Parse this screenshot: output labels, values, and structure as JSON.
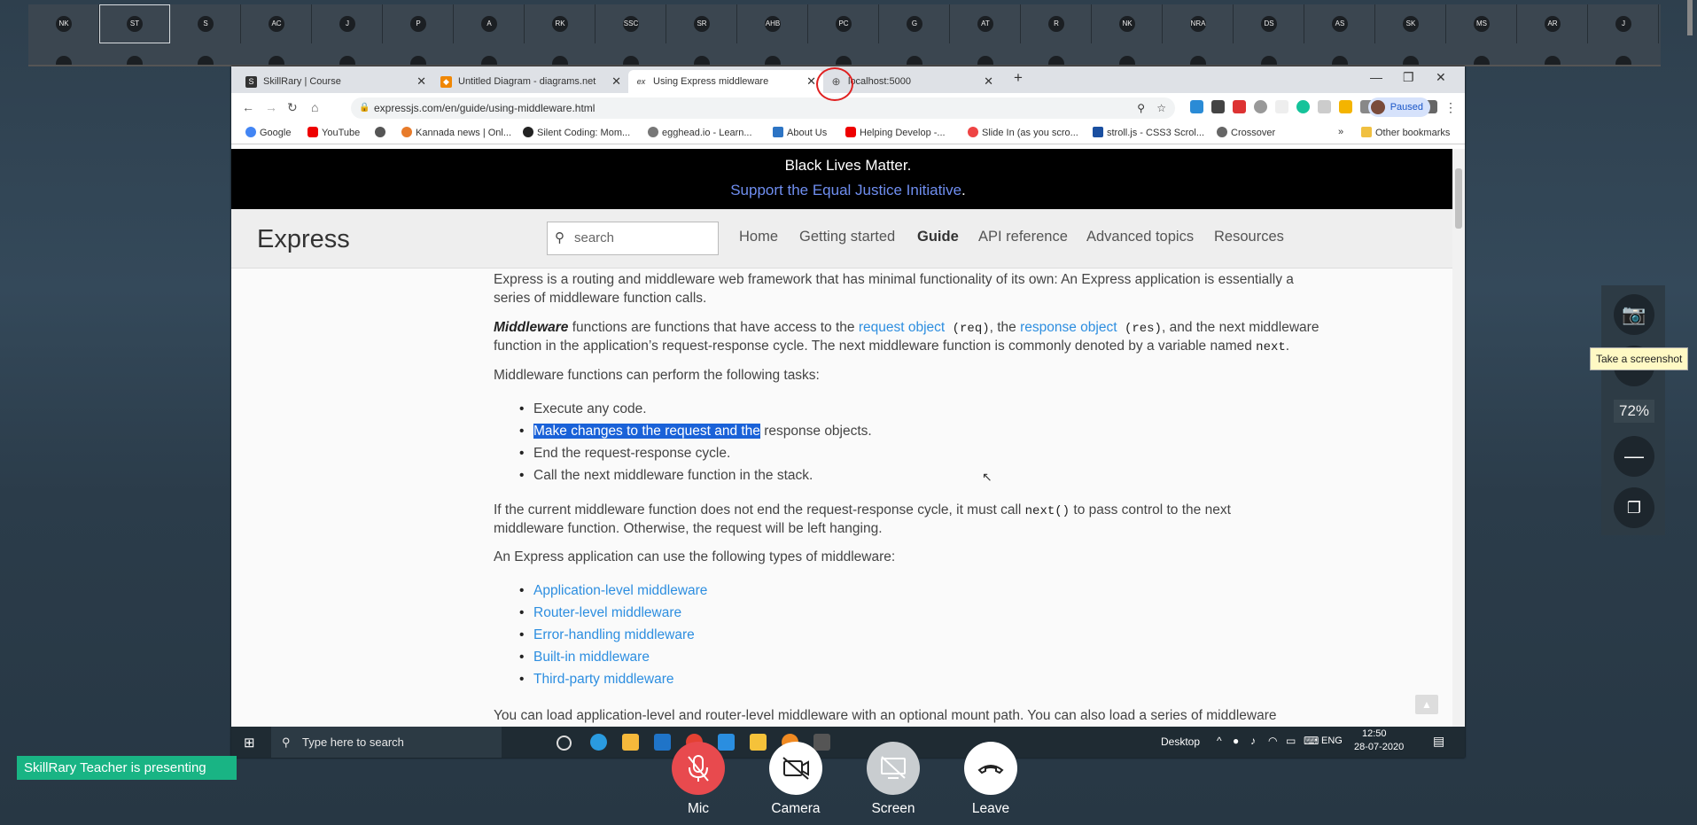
{
  "participants": [
    "NK",
    "ST",
    "S",
    "AC",
    "J",
    "P",
    "A",
    "RK",
    "SSC",
    "SR",
    "AHB",
    "PC",
    "G",
    "AT",
    "R",
    "NK",
    "NRA",
    "DS",
    "AS",
    "SK",
    "MS",
    "AR",
    "J"
  ],
  "browser": {
    "tabs": [
      {
        "title": "SkillRary | Course",
        "favicon": "S"
      },
      {
        "title": "Untitled Diagram - diagrams.net",
        "favicon": "◆"
      },
      {
        "title": "Using Express middleware",
        "favicon": "ex"
      },
      {
        "title": "localhost:5000",
        "favicon": "⊕"
      }
    ],
    "new_tab": "+",
    "url": "expressjs.com/en/guide/using-middleware.html",
    "profile_label": "Paused",
    "bookmarks": [
      "Google",
      "YouTube",
      "",
      "Kannada news | Onl...",
      "Silent Coding: Mom...",
      "egghead.io - Learn...",
      "About Us",
      "Helping Develop -...",
      "Slide In (as you scro...",
      "stroll.js - CSS3 Scrol...",
      "Crossover"
    ],
    "bookmarks_more": "»",
    "other_bookmarks": "Other bookmarks"
  },
  "page": {
    "banner_line1": "Black Lives Matter.",
    "banner_link": "Support the Equal Justice Initiative",
    "banner_dot": ".",
    "logo": "Express",
    "search_placeholder": "search",
    "nav": [
      "Home",
      "Getting started",
      "Guide",
      "API reference",
      "Advanced topics",
      "Resources"
    ],
    "intro_line1": "Express is a routing and middleware web framework that has minimal functionality of its own: An Express application is essentially a",
    "intro_line2": "series of middleware function calls.",
    "mw_bold": "Middleware",
    "mw_text1": " functions are functions that have access to the ",
    "mw_link1": "request object",
    "mw_code1": " (req)",
    "mw_text2": ", the ",
    "mw_link2": "response object",
    "mw_code2": " (res)",
    "mw_text3": ", and the next middleware",
    "mw_line2": "function in the application’s request-response cycle. The next middleware function is commonly denoted by a variable named ",
    "mw_code3": "next",
    "mw_end": ".",
    "tasks_intro": "Middleware functions can perform the following tasks:",
    "tasks": [
      "Execute any code.",
      "Make changes to the request and the response objects.",
      "End the request-response cycle.",
      "Call the next middleware function in the stack."
    ],
    "task2_highlight": "Make changes to the request and the",
    "task2_rest": " response objects.",
    "next_line1a": "If the current middleware function does not end the request-response cycle, it must call ",
    "next_code": "next()",
    "next_line1b": " to pass control to the next",
    "next_line2": "middleware function. Otherwise, the request will be left hanging.",
    "types_intro": "An Express application can use the following types of middleware:",
    "types": [
      "Application-level middleware",
      "Router-level middleware",
      "Error-handling middleware",
      "Built-in middleware",
      "Third-party middleware"
    ],
    "cut_line": "You can load application-level and router-level middleware with an optional mount path. You can also load a series of middleware"
  },
  "taskbar": {
    "search_placeholder": "Type here to search",
    "desktop_label": "Desktop",
    "lang": "ENG",
    "time": "12:50",
    "date": "28-07-2020"
  },
  "zoom": {
    "value": "72%",
    "tooltip": "Take a screenshot"
  },
  "meeting": {
    "presenting": "SkillRary Teacher is presenting",
    "controls": [
      "Mic",
      "Camera",
      "Screen",
      "Leave"
    ]
  }
}
